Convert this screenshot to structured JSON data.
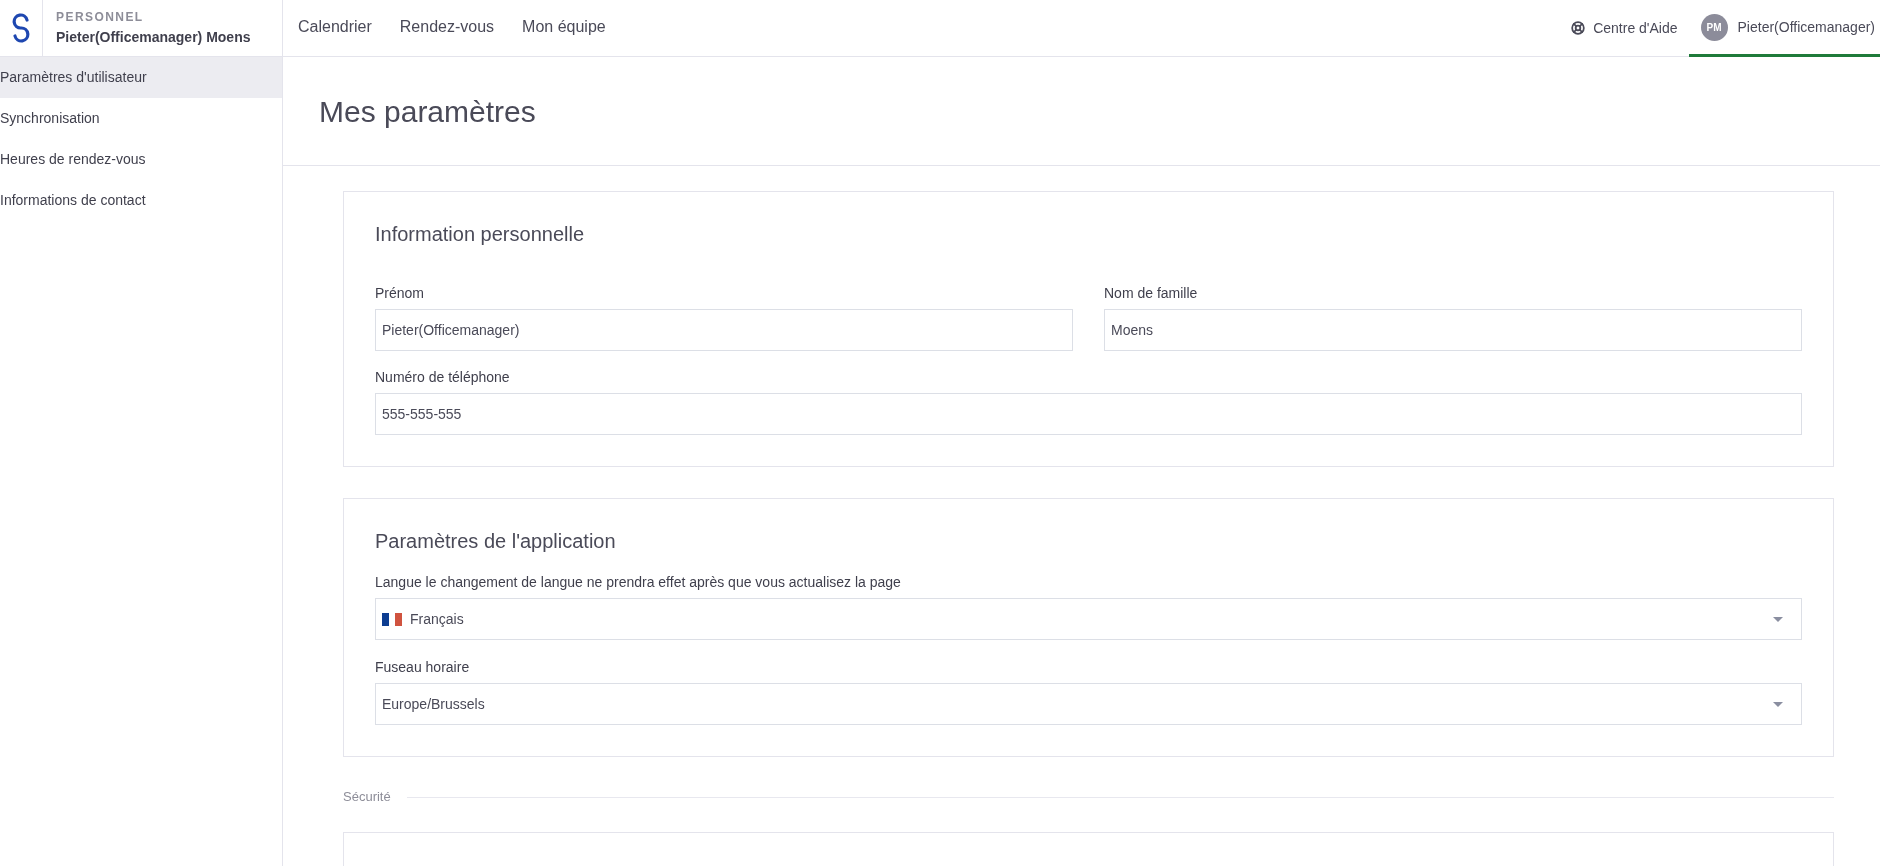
{
  "header": {
    "section": "PERSONNEL",
    "user_name": "Pieter(Officemanager) Moens"
  },
  "nav": [
    {
      "label": "Calendrier",
      "selected": false
    },
    {
      "label": "Rendez-vous",
      "selected": false
    },
    {
      "label": "Mon équipe",
      "selected": false
    }
  ],
  "help": {
    "label": "Centre d'Aide"
  },
  "account": {
    "initials": "PM",
    "name": "Pieter(Officemanager)",
    "selected": true
  },
  "sidebar": {
    "items": [
      {
        "label": "Paramètres d'utilisateur",
        "selected": true
      },
      {
        "label": "Synchronisation",
        "selected": false
      },
      {
        "label": "Heures de rendez-vous",
        "selected": false
      },
      {
        "label": "Informations de contact",
        "selected": false
      }
    ]
  },
  "page_title": "Mes paramètres",
  "sections": [
    {
      "kind": "card",
      "title": "Information personnelle",
      "rows": [
        {
          "fields": [
            {
              "kind": "text",
              "label": "Prénom",
              "value": "Pieter(Officemanager)"
            },
            {
              "kind": "text",
              "label": "Nom de famille",
              "value": "Moens"
            }
          ]
        },
        {
          "fields": [
            {
              "kind": "text",
              "label": "Numéro de téléphone",
              "value": "555-555-555"
            }
          ]
        }
      ]
    },
    {
      "kind": "card",
      "title": "Paramètres de l'application",
      "rows": [
        {
          "fields": [
            {
              "kind": "language_select",
              "label": "Langue le changement de langue ne prendra effet après que vous actualisez la page",
              "value": "Français"
            }
          ]
        },
        {
          "fields": [
            {
              "kind": "select",
              "label": "Fuseau horaire",
              "value": "Europe/Brussels"
            }
          ]
        }
      ]
    },
    {
      "kind": "group",
      "title": "Sécurité"
    }
  ]
}
